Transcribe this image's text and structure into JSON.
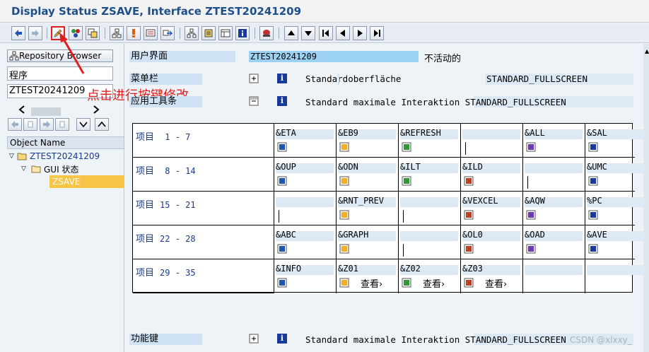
{
  "window": {
    "title": "Display Status ZSAVE, Interface ZTEST20241209"
  },
  "left": {
    "repository_browser": "Repository Browser",
    "object_type": "程序",
    "object_name": "ZTEST20241209",
    "tree_header": "Object Name",
    "tree": [
      "ZTEST20241209",
      "GUI 状态",
      "ZSAVE"
    ]
  },
  "annotation": "点击进行按键修改",
  "main": {
    "user_interface_label": "用户界面",
    "user_interface_value": "ZTEST20241209",
    "inactive": "不活动的",
    "menubar_label": "菜单栏",
    "menubar_text": "Standardoberfläche",
    "menubar_code": "STANDARD_FULLSCREEN",
    "apptoolbar_label": "应用工具条",
    "apptoolbar_text": "Standard maximale Interaktion",
    "apptoolbar_code": "STANDARD_FULLSCREEN",
    "funckeys_label": "功能键",
    "funckeys_text": "Standard maximale Interaktion",
    "funckeys_code": "STANDARD_FULLSCREEN"
  },
  "grid": {
    "rows": [
      {
        "label": "项目",
        "range": " 1 -  7",
        "cells": [
          "&ETA",
          "&EB9",
          "&REFRESH",
          "",
          "&ALL",
          "&SAL"
        ]
      },
      {
        "label": "项目",
        "range": " 8 - 14",
        "cells": [
          "&OUP",
          "&ODN",
          "&ILT",
          "&ILD",
          "",
          "&UMC"
        ]
      },
      {
        "label": "项目",
        "range": "15 - 21",
        "cells": [
          "",
          "&RNT_PREV",
          "",
          "&VEXCEL",
          "&AQW",
          "%PC"
        ]
      },
      {
        "label": "项目",
        "range": "22 - 28",
        "cells": [
          "&ABC",
          "&GRAPH",
          "",
          "&OL0",
          "&OAD",
          "&AVE"
        ]
      },
      {
        "label": "项目",
        "range": "29 - 35",
        "cells": [
          "&INFO",
          "&Z01",
          "&Z02",
          "&Z03",
          "",
          ""
        ]
      }
    ],
    "view_label": "查看"
  },
  "watermark": "CSDN @xlxxy_",
  "colors": {
    "title": "#1f4f8a",
    "highlight": "#e02020",
    "selected": "#f7c548"
  }
}
